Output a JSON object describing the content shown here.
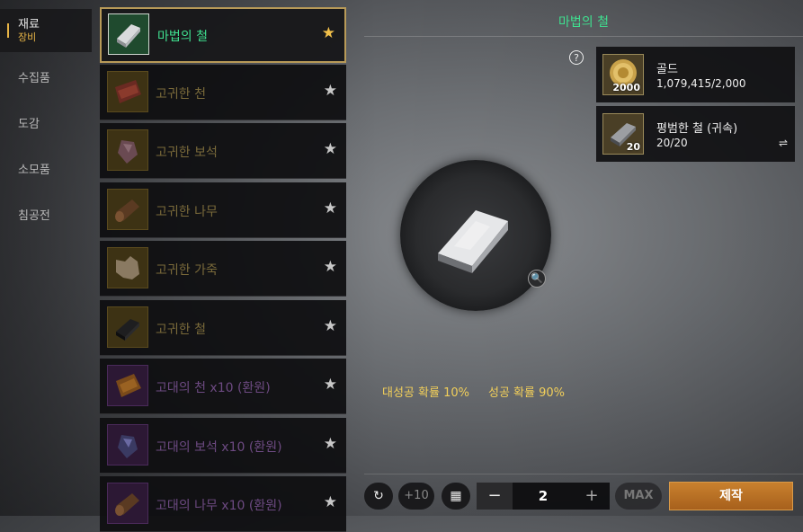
{
  "nav": {
    "items": [
      {
        "label": "재료",
        "sub": "장비"
      },
      {
        "label": "수집품"
      },
      {
        "label": "도감"
      },
      {
        "label": "소모품"
      },
      {
        "label": "침공전"
      }
    ]
  },
  "list": {
    "items": [
      {
        "label": "마법의 철",
        "icon": "iron-bar-icon"
      },
      {
        "label": "고귀한 천",
        "icon": "cloth-icon"
      },
      {
        "label": "고귀한 보석",
        "icon": "gem-icon"
      },
      {
        "label": "고귀한 나무",
        "icon": "wood-log-icon"
      },
      {
        "label": "고귀한 가죽",
        "icon": "leather-hide-icon"
      },
      {
        "label": "고귀한 철",
        "icon": "iron-bar-icon"
      },
      {
        "label": "고대의 천 x10 (환원)",
        "icon": "cloth-icon"
      },
      {
        "label": "고대의 보석 x10 (환원)",
        "icon": "gem-icon"
      },
      {
        "label": "고대의 나무 x10 (환원)",
        "icon": "wood-log-icon"
      }
    ],
    "star_glyph": "★"
  },
  "detail": {
    "title": "마법의 철",
    "help_glyph": "?",
    "materials": [
      {
        "name": "골드",
        "count": "1,079,415/2,000",
        "qty": "2000",
        "icon": "gold-coin-icon"
      },
      {
        "name": "평범한 철 (귀속)",
        "count": "20/20",
        "qty": "20",
        "icon": "iron-bar-icon"
      }
    ],
    "swap_glyph": "⇌",
    "zoom_glyph": "🔍",
    "great_success": "대성공 확률 10%",
    "success": "성공 확률 90%"
  },
  "controls": {
    "reset_glyph": "↻",
    "plus10": "+10",
    "calc_glyph": "▦",
    "minus": "−",
    "quantity": "2",
    "plus": "+",
    "max": "MAX",
    "make": "제작"
  },
  "colors": {
    "selected_text": "#3fe090",
    "accent_gold": "#e7b446",
    "rate_text": "#f2cf5a",
    "make_button": "#b86c22"
  }
}
